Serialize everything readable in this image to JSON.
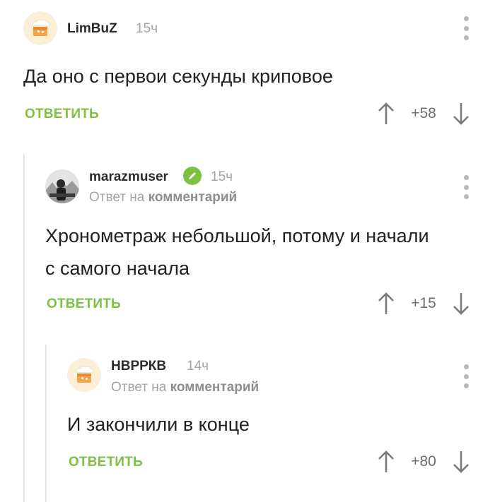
{
  "comments": [
    {
      "author": "LimBuZ",
      "time": "15ч",
      "text": "Да оно с первои секунды криповое",
      "reply_label": "ОТВЕТИТЬ",
      "score": "+58"
    },
    {
      "author": "marazmuser",
      "time": "15ч",
      "reply_prefix": "Ответ на",
      "reply_target": "комментарий",
      "text_line1": "Хронометраж небольшой, потому и начали",
      "text_line2": "с самого начала",
      "reply_label": "ОТВЕТИТЬ",
      "score": "+15"
    },
    {
      "author": "НВРРКВ",
      "time": "14ч",
      "reply_prefix": "Ответ на",
      "reply_target": "комментарий",
      "text": "И закончили в конце",
      "reply_label": "ОТВЕТИТЬ",
      "score": "+80"
    }
  ],
  "colors": {
    "accent": "#7fc043",
    "muted": "#a4a4a4",
    "text": "#222222"
  },
  "icons": [
    "cake-avatar-icon",
    "photo-avatar",
    "pencil-icon",
    "more-vertical-icon",
    "arrow-up-icon",
    "arrow-down-icon"
  ]
}
